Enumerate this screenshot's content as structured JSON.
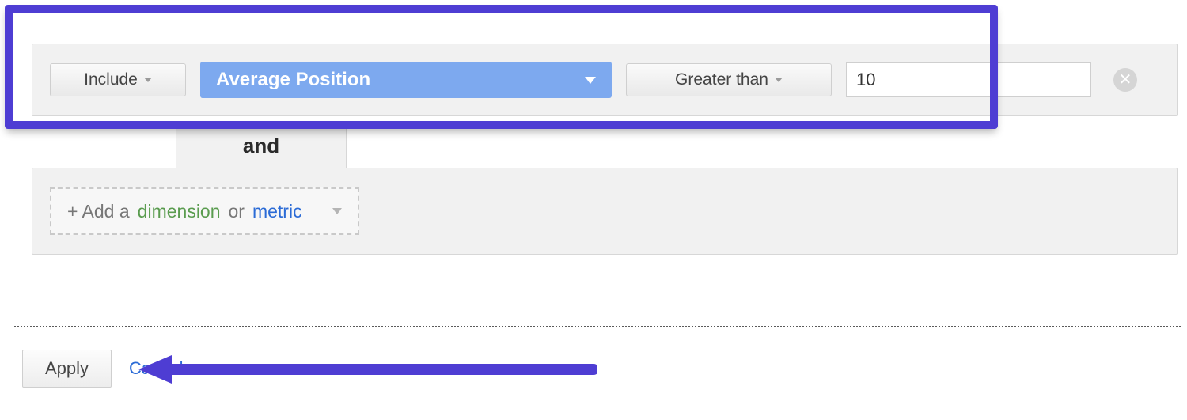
{
  "colors": {
    "highlight": "#4e3dd3",
    "pill": "#7da9ef",
    "dim": "#5a9c4f",
    "met": "#2b6bd6"
  },
  "filter_row": {
    "include_label": "Include",
    "metric_label": "Average Position",
    "condition_label": "Greater than",
    "value": "10"
  },
  "and_label": "and",
  "add_row": {
    "prefix": "+ Add a ",
    "dimension_word": "dimension",
    "or_word": " or ",
    "metric_word": "metric"
  },
  "buttons": {
    "apply": "Apply",
    "cancel": "Cancel"
  }
}
